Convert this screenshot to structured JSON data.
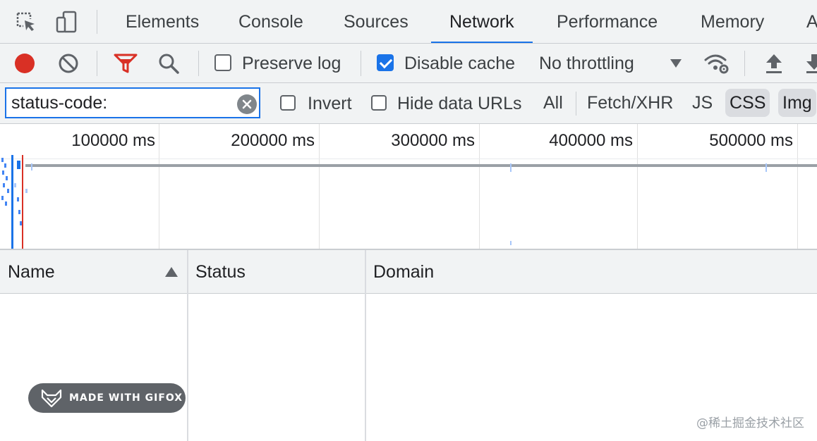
{
  "tabs": [
    {
      "label": "Elements"
    },
    {
      "label": "Console"
    },
    {
      "label": "Sources"
    },
    {
      "label": "Network"
    },
    {
      "label": "Performance"
    },
    {
      "label": "Memory"
    },
    {
      "label": "A"
    }
  ],
  "active_tab": "Network",
  "toolbar": {
    "preserve_log_label": "Preserve log",
    "preserve_log_checked": false,
    "disable_cache_label": "Disable cache",
    "disable_cache_checked": true,
    "throttling_value": "No throttling"
  },
  "filter": {
    "value": "status-code:",
    "invert_label": "Invert",
    "hide_data_urls_label": "Hide data URLs",
    "types": [
      {
        "label": "All",
        "selected": false
      },
      {
        "label": "Fetch/XHR",
        "selected": false
      },
      {
        "label": "JS",
        "selected": false
      },
      {
        "label": "CSS",
        "selected": true
      },
      {
        "label": "Img",
        "selected": true
      }
    ]
  },
  "timeline": {
    "ticks": [
      "100000 ms",
      "200000 ms",
      "300000 ms",
      "400000 ms",
      "500000 ms"
    ]
  },
  "table": {
    "columns": [
      {
        "label": "Name",
        "sorted": "ascending"
      },
      {
        "label": "Status"
      },
      {
        "label": "Domain"
      }
    ],
    "rows": []
  },
  "overlays": {
    "gifox_badge": "MADE WITH GIFOX",
    "watermark": "@稀土掘金技术社区"
  },
  "colors": {
    "accent": "#1a73e8",
    "record": "#d93025",
    "filter_active": "#d93025"
  }
}
